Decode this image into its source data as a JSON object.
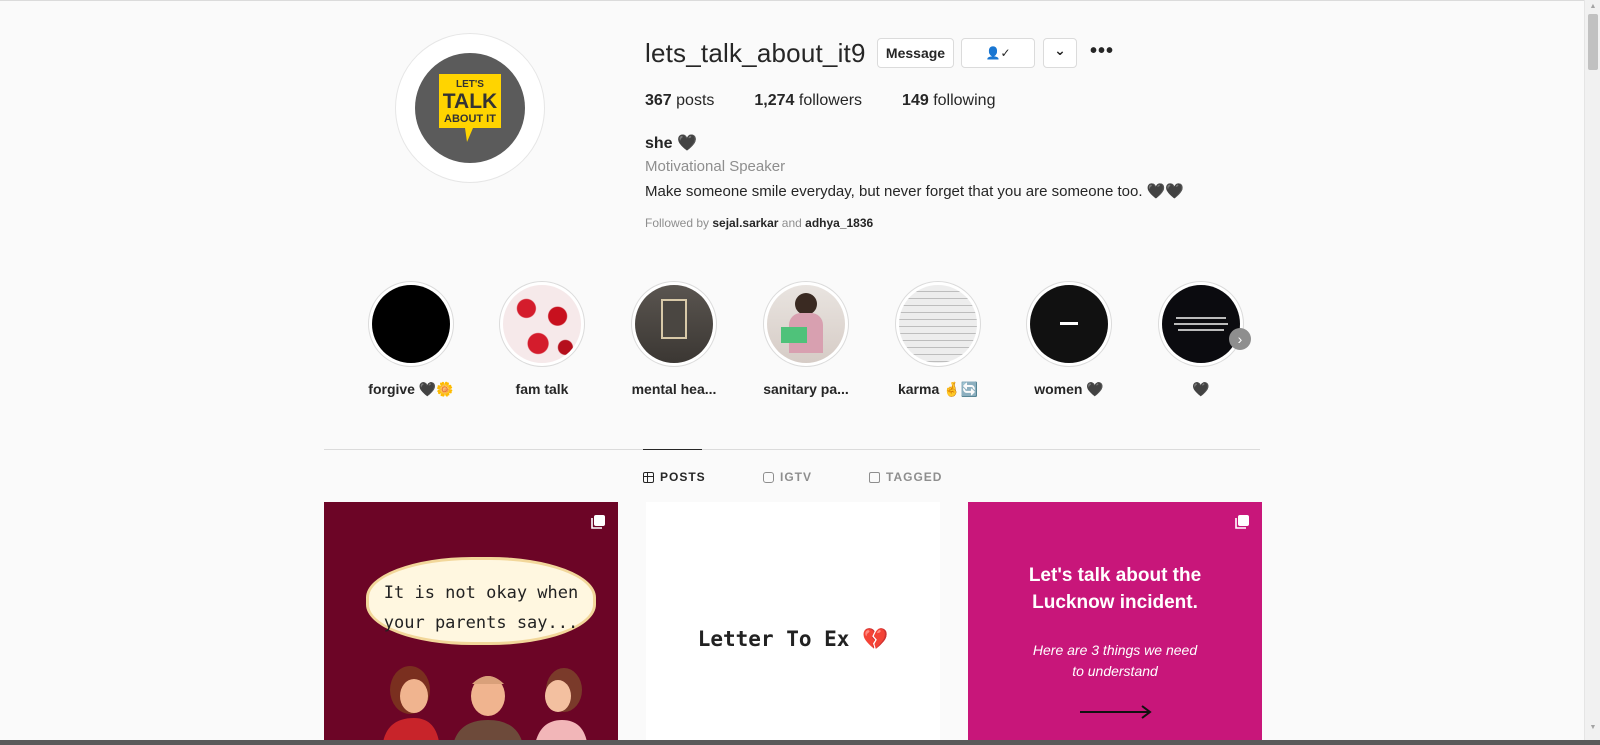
{
  "profile": {
    "username": "lets_talk_about_it9",
    "avatar_text": [
      "LET'S",
      "TALK",
      "ABOUT IT"
    ],
    "buttons": {
      "message": "Message",
      "following_icon": "👤✓",
      "dropdown_icon": "⌄",
      "more": "•••"
    },
    "stats": {
      "posts_count": "367",
      "posts_label": "posts",
      "followers_count": "1,274",
      "followers_label": "followers",
      "following_count": "149",
      "following_label": "following"
    },
    "name": "she 🖤",
    "category": "Motivational Speaker",
    "bio": "Make someone smile everyday, but never forget that you are someone too. 🖤🖤",
    "followed_by_prefix": "Followed by",
    "followed_by_user1": "sejal.sarkar",
    "followed_by_and": "and",
    "followed_by_user2": "adhya_1836"
  },
  "highlights": [
    {
      "label": "forgive 🖤🌼"
    },
    {
      "label": "fam talk"
    },
    {
      "label": "mental hea..."
    },
    {
      "label": "sanitary pa..."
    },
    {
      "label": "karma 🤞🔄"
    },
    {
      "label": "women 🖤"
    },
    {
      "label": "🖤"
    }
  ],
  "tabs": {
    "posts": "POSTS",
    "igtv": "IGTV",
    "tagged": "TAGGED"
  },
  "posts": [
    {
      "text_line1": "It is not okay when",
      "text_line2": "your parents say..."
    },
    {
      "text": "Letter To Ex 💔"
    },
    {
      "title_line1": "Let's talk about the",
      "title_line2": "Lucknow incident.",
      "sub_line1": "Here are 3 things we need",
      "sub_line2": "to understand"
    }
  ],
  "colors": {
    "accent_yellow": "#ffd400",
    "post1_bg": "#6c0526",
    "post3_bg": "#c8167a"
  }
}
